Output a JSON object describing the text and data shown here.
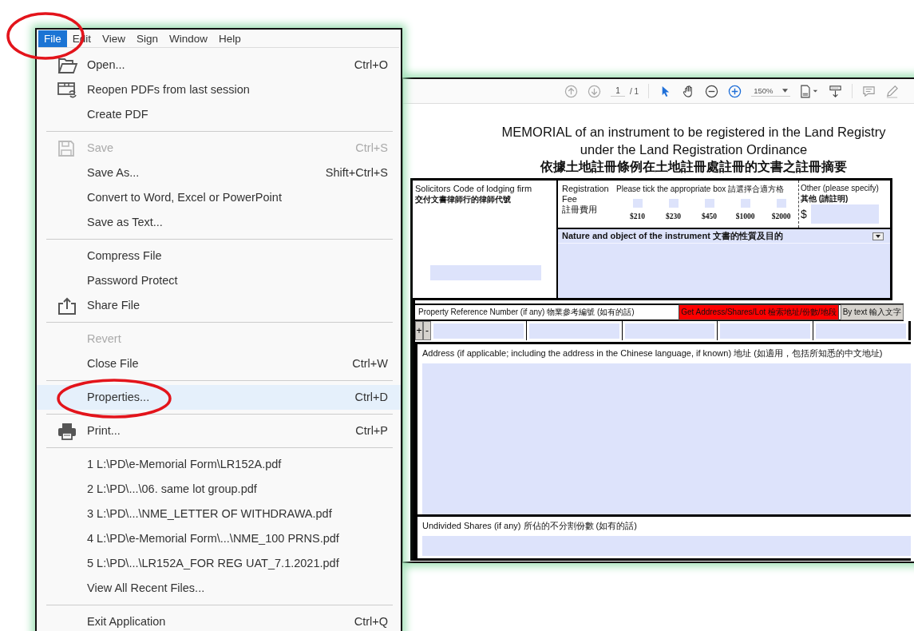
{
  "menu_bar": [
    {
      "label": "File",
      "selected": true
    },
    {
      "label": "Edit",
      "selected": false
    },
    {
      "label": "View",
      "selected": false
    },
    {
      "label": "Sign",
      "selected": false
    },
    {
      "label": "Window",
      "selected": false
    },
    {
      "label": "Help",
      "selected": false
    }
  ],
  "file_menu": [
    [
      {
        "kind": "folder",
        "label": "Open...",
        "shortcut": "Ctrl+O",
        "disabled": false,
        "selected": false
      },
      {
        "kind": "reopen",
        "label": "Reopen PDFs from last session",
        "disabled": false,
        "selected": false
      },
      {
        "kind": "plain",
        "label": "Create PDF",
        "disabled": false,
        "selected": false
      }
    ],
    [
      {
        "kind": "disk",
        "label": "Save",
        "shortcut": "Ctrl+S",
        "disabled": true,
        "selected": false
      },
      {
        "kind": "plain",
        "label": "Save As...",
        "shortcut": "Shift+Ctrl+S",
        "disabled": false,
        "selected": false
      },
      {
        "kind": "plain",
        "label": "Convert to Word, Excel or PowerPoint",
        "disabled": false,
        "selected": false
      },
      {
        "kind": "plain",
        "label": "Save as Text...",
        "disabled": false,
        "selected": false
      }
    ],
    [
      {
        "kind": "plain",
        "label": "Compress File",
        "disabled": false,
        "selected": false
      },
      {
        "kind": "plain",
        "label": "Password Protect",
        "disabled": false,
        "selected": false
      },
      {
        "kind": "share",
        "label": "Share File",
        "disabled": false,
        "selected": false
      }
    ],
    [
      {
        "kind": "plain",
        "label": "Revert",
        "disabled": true,
        "selected": false
      },
      {
        "kind": "plain",
        "label": "Close File",
        "shortcut": "Ctrl+W",
        "disabled": false,
        "selected": false
      }
    ],
    [
      {
        "kind": "plain",
        "label": "Properties...",
        "shortcut": "Ctrl+D",
        "disabled": false,
        "selected": true
      }
    ],
    [
      {
        "kind": "printer",
        "label": "Print...",
        "shortcut": "Ctrl+P",
        "disabled": false,
        "selected": false
      }
    ],
    [
      {
        "kind": "plain",
        "label": "1 L:\\PD\\e-Memorial Form\\LR152A.pdf",
        "disabled": false,
        "selected": false
      },
      {
        "kind": "plain",
        "label": "2 L:\\PD\\...\\06. same lot group.pdf",
        "disabled": false,
        "selected": false
      },
      {
        "kind": "plain",
        "label": "3 L:\\PD\\...\\NME_LETTER OF WITHDRAWA.pdf",
        "disabled": false,
        "selected": false
      },
      {
        "kind": "plain",
        "label": "4 L:\\PD\\e-Memorial Form\\...\\NME_100 PRNS.pdf",
        "disabled": false,
        "selected": false
      },
      {
        "kind": "plain",
        "label": "5 L:\\PD\\...\\LR152A_FOR REG UAT_7.1.2021.pdf",
        "disabled": false,
        "selected": false
      },
      {
        "kind": "plain",
        "label": "View All Recent Files...",
        "disabled": false,
        "selected": false
      }
    ],
    [
      {
        "kind": "plain",
        "label": "Exit Application",
        "shortcut": "Ctrl+Q",
        "disabled": false,
        "selected": false
      }
    ]
  ],
  "toolbar": {
    "page": "1",
    "page_total": "/ 1",
    "zoom": "150%"
  },
  "document": {
    "title_lines": [
      "MEMORIAL of an instrument to be registered in the Land Registry",
      "under the Land Registration Ordinance",
      "依據土地註冊條例在土地註冊處註冊的文書之註冊摘要"
    ],
    "solicitor": {
      "label": "Solicitors Code of lodging firm",
      "label_zh": "交付文書律師行的律師代號"
    },
    "fee": {
      "label_lines": [
        "Registration",
        "Fee",
        "註冊費用"
      ],
      "instruction": "Please tick the appropriate box 請選擇合適方格",
      "options": [
        {
          "amount": "$210",
          "checked": false
        },
        {
          "amount": "$230",
          "checked": false
        },
        {
          "amount": "$450",
          "checked": false
        },
        {
          "amount": "$1000",
          "checked": false
        },
        {
          "amount": "$2000",
          "checked": false
        }
      ],
      "other_label": "Other (please specify)",
      "other_label_zh": "其他 (請註明)",
      "currency": "$"
    },
    "nature_label": "Nature and object of the instrument 文書的性質及目的",
    "property_ref": {
      "label": "Property Reference Number (if any) 物業參考編號 (如有的話)",
      "lookup_button": "Get Address/Shares/Lot 檢索地址/份數/地段",
      "text_button": "By text 輸入文字",
      "add": "+",
      "remove": "-"
    },
    "address_label": "Address (if applicable; including the address in the Chinese language, if known) 地址 (如適用，包括所知悉的中文地址)",
    "shares_label": "Undivided Shares (if any) 所佔的不分割份數 (如有的話)"
  }
}
